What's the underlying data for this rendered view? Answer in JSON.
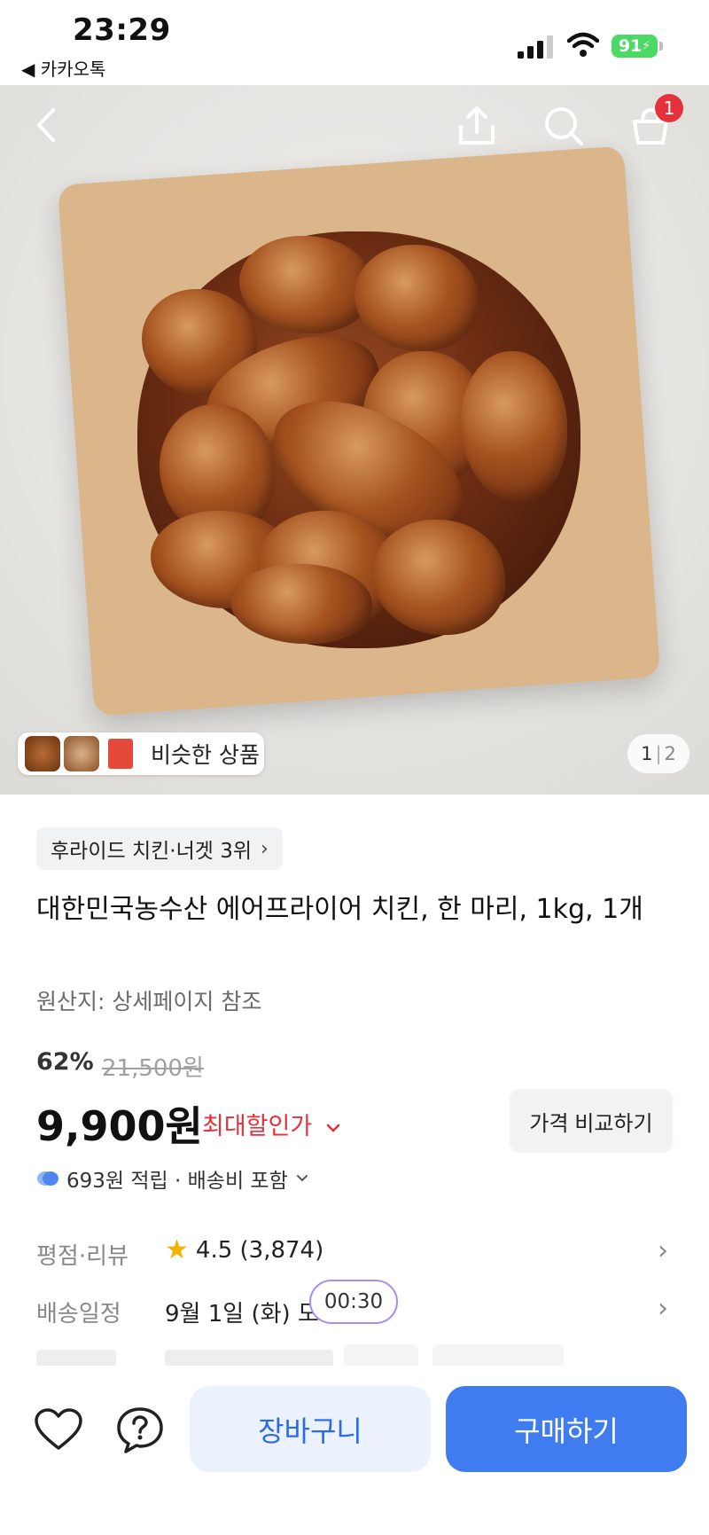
{
  "status_bar": {
    "time": "23:29",
    "back_app": "◀ 카카오톡",
    "battery": "91"
  },
  "nav": {
    "cart_badge": "1"
  },
  "gallery": {
    "similar_label": "비슷한 상품",
    "page_current": "1",
    "page_separator": "|",
    "page_total": "2"
  },
  "product": {
    "rank_label": "후라이드 치킨·너겟 3위",
    "title": "대한민국농수산 에어프라이어 치킨, 한 마리, 1kg, 1개",
    "origin": "원산지: 상세페이지 참조",
    "discount_rate": "62%",
    "original_price": "21,500원",
    "price": "9,900원",
    "max_discount_label": "최대할인가",
    "compare_button": "가격 비교하기",
    "points_text": "693원 적립 · 배송비 포함"
  },
  "info_rows": {
    "rating_label": "평점·리뷰",
    "rating_value": "4.5 (3,874)",
    "delivery_label": "배송일정",
    "delivery_value": "9월 1일 (화) 도",
    "timer": "00:30"
  },
  "bottom": {
    "cart_button": "장바구니",
    "buy_button": "구매하기"
  },
  "colors": {
    "accent": "#3f7cf0",
    "sale_red": "#e5323a",
    "cart_bg": "#ebf2fd"
  }
}
